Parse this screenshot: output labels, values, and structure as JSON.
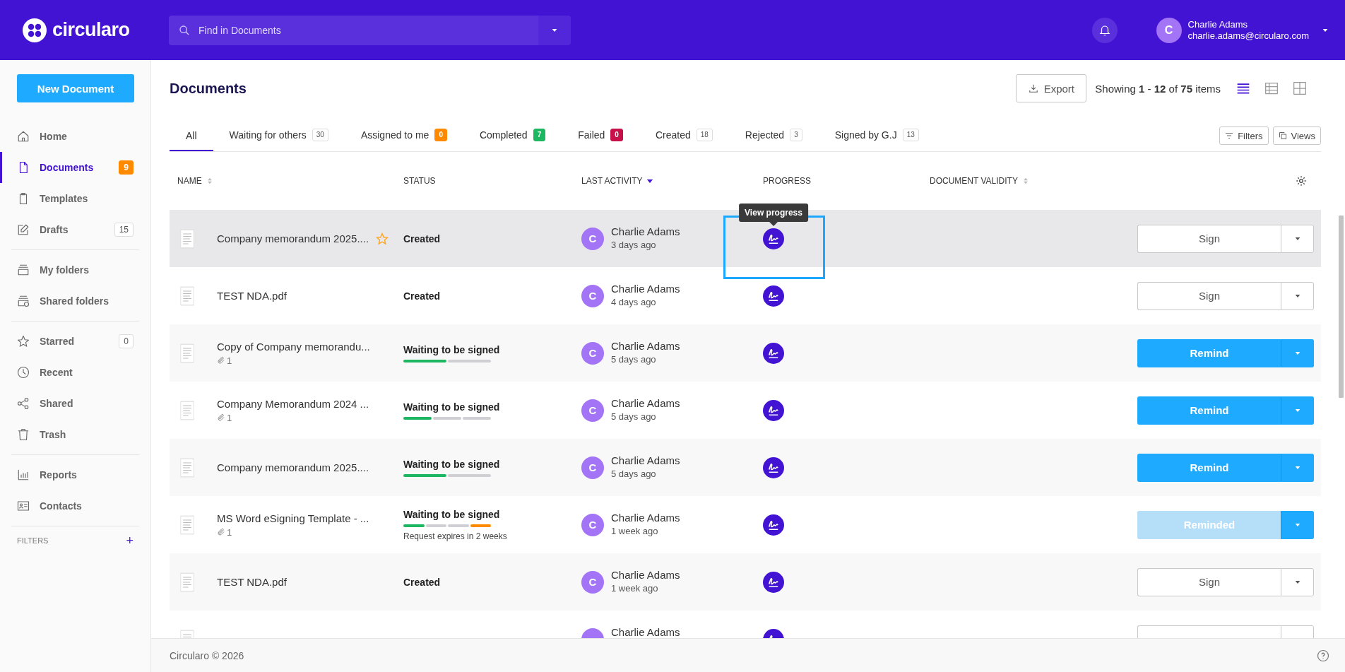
{
  "header": {
    "logo": "circularo",
    "search": {
      "placeholder": "Find in Documents"
    },
    "user": {
      "initial": "C",
      "name": "Charlie Adams",
      "email": "charlie.adams@circularo.com"
    }
  },
  "sidebar": {
    "new_button": "New Document",
    "groups": [
      [
        {
          "label": "Home",
          "selected": false
        },
        {
          "label": "Documents",
          "selected": true,
          "badge": {
            "count": "9",
            "kind": "warning"
          }
        },
        {
          "label": "Templates",
          "selected": false
        },
        {
          "label": "Drafts",
          "selected": false,
          "badge": {
            "count": "15",
            "kind": "plain"
          }
        }
      ],
      [
        {
          "label": "My folders",
          "selected": false
        },
        {
          "label": "Shared folders",
          "selected": false
        }
      ],
      [
        {
          "label": "Starred",
          "selected": false,
          "badge": {
            "count": "0",
            "kind": "plain"
          }
        },
        {
          "label": "Recent",
          "selected": false
        },
        {
          "label": "Shared",
          "selected": false
        },
        {
          "label": "Trash",
          "selected": false
        }
      ],
      [
        {
          "label": "Reports",
          "selected": false
        },
        {
          "label": "Contacts",
          "selected": false
        }
      ]
    ],
    "filters": {
      "label": "FILTERS",
      "add": "+"
    }
  },
  "page": {
    "title": "Documents",
    "export": "Export",
    "showing": "Showing **1** - **12** of **75** items",
    "views": [
      {
        "selected": true
      },
      {
        "selected": false
      },
      {
        "selected": false
      }
    ]
  },
  "tabs": [
    {
      "label": "All",
      "selected": true
    },
    {
      "label": "Waiting for others",
      "selected": false,
      "badge": {
        "count": "30",
        "kind": "plain"
      }
    },
    {
      "label": "Assigned to me",
      "selected": false,
      "badge": {
        "count": "0",
        "kind": "warning"
      }
    },
    {
      "label": "Completed",
      "selected": false,
      "badge": {
        "count": "7",
        "kind": "success"
      }
    },
    {
      "label": "Failed",
      "selected": false,
      "badge": {
        "count": "0",
        "kind": "danger"
      }
    },
    {
      "label": "Created",
      "selected": false,
      "badge": {
        "count": "18",
        "kind": "plain"
      }
    },
    {
      "label": "Rejected",
      "selected": false,
      "badge": {
        "count": "3",
        "kind": "plain"
      }
    },
    {
      "label": "Signed by G.J",
      "selected": false,
      "badge": {
        "count": "13",
        "kind": "plain"
      }
    }
  ],
  "tools": {
    "filters": "Filters",
    "views": "Views"
  },
  "table": {
    "columns": [
      {
        "label": "NAME",
        "sortable": true,
        "sorted": false
      },
      {
        "label": "STATUS",
        "sortable": false,
        "sorted": false
      },
      {
        "label": "LAST ACTIVITY",
        "sortable": true,
        "sorted": true
      },
      {
        "label": "PROGRESS",
        "sortable": false,
        "sorted": false
      },
      {
        "label": "DOCUMENT VALIDITY",
        "sortable": true,
        "sorted": false
      }
    ],
    "rows": [
      {
        "name": "Company memorandum 2025....",
        "starred": true,
        "hovered": true,
        "status": "Created",
        "initial": "C",
        "author": "Charlie Adams",
        "time": "3 days ago",
        "progress_tooltip": "View progress",
        "progress_highlighted": true,
        "action": {
          "kind": "sign",
          "label": "Sign"
        }
      },
      {
        "name": "TEST NDA.pdf",
        "starred": false,
        "hovered": false,
        "status": "Created",
        "initial": "C",
        "author": "Charlie Adams",
        "time": "4 days ago",
        "action": {
          "kind": "sign",
          "label": "Sign"
        }
      },
      {
        "name": "Copy of Company memorandu...",
        "attachments": "1",
        "starred": false,
        "hovered": false,
        "status": "Waiting to be signed",
        "steps": [
          {
            "color": "#1cb760"
          },
          {
            "color": "#d0d0d4"
          }
        ],
        "initial": "C",
        "author": "Charlie Adams",
        "time": "5 days ago",
        "action": {
          "kind": "remind",
          "label": "Remind"
        }
      },
      {
        "name": "Company Memorandum 2024 ...",
        "attachments": "1",
        "starred": false,
        "hovered": false,
        "status": "Waiting to be signed",
        "steps": [
          {
            "color": "#1cb760"
          },
          {
            "color": "#d0d0d4"
          },
          {
            "color": "#d0d0d4"
          }
        ],
        "initial": "C",
        "author": "Charlie Adams",
        "time": "5 days ago",
        "action": {
          "kind": "remind",
          "label": "Remind"
        }
      },
      {
        "name": "Company memorandum 2025....",
        "starred": false,
        "hovered": false,
        "status": "Waiting to be signed",
        "steps": [
          {
            "color": "#1cb760"
          },
          {
            "color": "#d0d0d4"
          }
        ],
        "initial": "C",
        "author": "Charlie Adams",
        "time": "5 days ago",
        "action": {
          "kind": "remind",
          "label": "Remind"
        }
      },
      {
        "name": "MS Word eSigning Template - ...",
        "attachments": "1",
        "starred": false,
        "hovered": false,
        "status": "Waiting to be signed",
        "steps": [
          {
            "color": "#1cb760"
          },
          {
            "color": "#d0d0d4"
          },
          {
            "color": "#d0d0d4"
          },
          {
            "color": "#ff8a00"
          }
        ],
        "note": "Request expires in 2 weeks",
        "initial": "C",
        "author": "Charlie Adams",
        "time": "1 week ago",
        "action": {
          "kind": "reminded",
          "label": "Reminded"
        }
      },
      {
        "name": "TEST NDA.pdf",
        "starred": false,
        "hovered": false,
        "status": "Created",
        "initial": "C",
        "author": "Charlie Adams",
        "time": "1 week ago",
        "action": {
          "kind": "sign",
          "label": "Sign"
        }
      },
      {
        "starred": false,
        "hovered": false,
        "author": "Charlie Adams",
        "action": {
          "kind": "sign"
        }
      }
    ]
  },
  "footer": {
    "copyright": "Circularo © 2026"
  }
}
